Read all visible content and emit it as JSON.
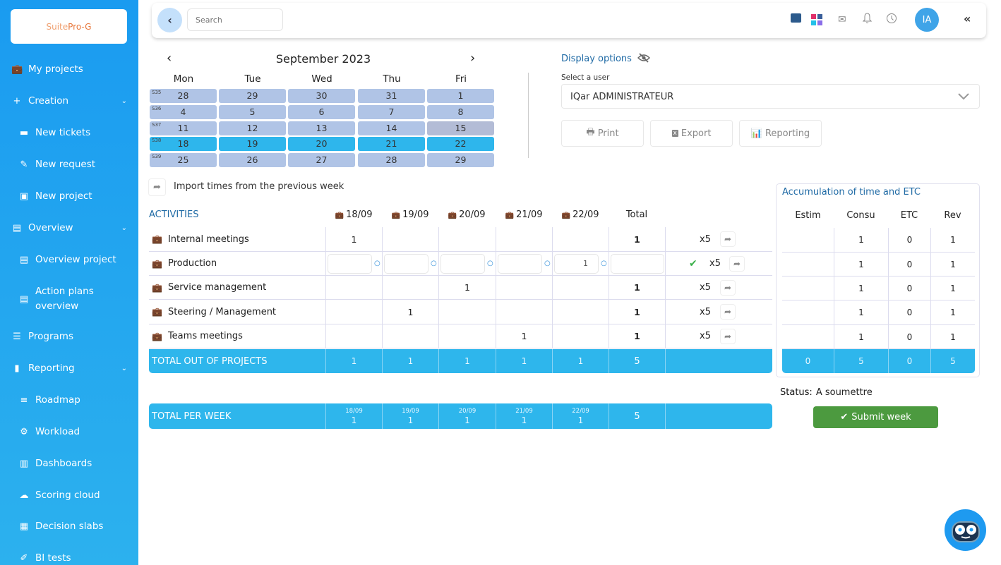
{
  "brand": {
    "logo_text_a": "Suite",
    "logo_text_b": "Pro-G"
  },
  "sidebar": {
    "items": [
      {
        "label": "My projects",
        "icon": "briefcase-icon",
        "glyph": "💼"
      },
      {
        "label": "Creation",
        "icon": "plus-icon",
        "glyph": "+"
      },
      {
        "label": "New tickets",
        "icon": "ticket-plus-icon",
        "glyph": "▬"
      },
      {
        "label": "New request",
        "icon": "paperclip-plus-icon",
        "glyph": "✎"
      },
      {
        "label": "New project",
        "icon": "briefcase-plus-icon",
        "glyph": "▣"
      },
      {
        "label": "Overview",
        "icon": "clipboard-icon",
        "glyph": "▤"
      },
      {
        "label": "Overview project",
        "icon": "clipboard-icon",
        "glyph": "▤"
      },
      {
        "label": "Action plans overview",
        "icon": "clipboard-icon",
        "glyph": "▤"
      },
      {
        "label": "Programs",
        "icon": "list-icon",
        "glyph": "☰"
      },
      {
        "label": "Reporting",
        "icon": "file-icon",
        "glyph": "▮"
      },
      {
        "label": "Roadmap",
        "icon": "roadmap-icon",
        "glyph": "≡"
      },
      {
        "label": "Workload",
        "icon": "users-gear-icon",
        "glyph": "⚙"
      },
      {
        "label": "Dashboards",
        "icon": "bar-chart-icon",
        "glyph": "▥"
      },
      {
        "label": "Scoring cloud",
        "icon": "cloud-icon",
        "glyph": "☁"
      },
      {
        "label": "Decision slabs",
        "icon": "table-icon",
        "glyph": "▦"
      },
      {
        "label": "BI tests",
        "icon": "test-tube-icon",
        "glyph": "✐"
      }
    ],
    "chevron": "⌄"
  },
  "topbar": {
    "search_placeholder": "Search",
    "avatar_initials": "IA",
    "collapse_glyph": "«",
    "back_glyph": "‹"
  },
  "calendar": {
    "title": "September 2023",
    "prev": "‹",
    "next": "›",
    "days": [
      "Mon",
      "Tue",
      "Wed",
      "Thu",
      "Fri"
    ],
    "weeks": [
      {
        "label": "S35",
        "dates": [
          "28",
          "29",
          "30",
          "31",
          "1"
        ]
      },
      {
        "label": "S36",
        "dates": [
          "4",
          "5",
          "6",
          "7",
          "8"
        ]
      },
      {
        "label": "S37",
        "dates": [
          "11",
          "12",
          "13",
          "14",
          "15"
        ]
      },
      {
        "label": "S38",
        "dates": [
          "18",
          "19",
          "20",
          "21",
          "22"
        ]
      },
      {
        "label": "S39",
        "dates": [
          "25",
          "26",
          "27",
          "28",
          "29"
        ]
      }
    ],
    "selected_week": "S38",
    "today": "15"
  },
  "display_options": {
    "title": "Display options",
    "select_label": "Select a user",
    "selected_user": "IQar ADMINISTRATEUR",
    "buttons": {
      "print": "Print",
      "export": "Export",
      "reporting": "Reporting"
    }
  },
  "import": {
    "label": "Import times from the previous week"
  },
  "timesheet": {
    "activities_header": "ACTIVITIES",
    "date_headers": [
      "18/09",
      "19/09",
      "20/09",
      "21/09",
      "22/09"
    ],
    "total_header": "Total",
    "rows": [
      {
        "name": "Internal meetings",
        "values": [
          "1",
          "",
          "",
          "",
          ""
        ],
        "total": "1",
        "multiplier": "x5",
        "editable": false
      },
      {
        "name": "Production",
        "values": [
          "",
          "",
          "",
          "",
          "1"
        ],
        "total": "",
        "multiplier": "x5",
        "editable": true
      },
      {
        "name": "Service management",
        "values": [
          "",
          "",
          "1",
          "",
          ""
        ],
        "total": "1",
        "multiplier": "x5",
        "editable": false
      },
      {
        "name": "Steering / Management",
        "values": [
          "",
          "1",
          "",
          "",
          ""
        ],
        "total": "1",
        "multiplier": "x5",
        "editable": false
      },
      {
        "name": "Teams meetings",
        "values": [
          "",
          "",
          "",
          "1",
          ""
        ],
        "total": "1",
        "multiplier": "x5",
        "editable": false
      }
    ],
    "total_out": {
      "label": "TOTAL OUT OF PROJECTS",
      "values": [
        "1",
        "1",
        "1",
        "1",
        "1"
      ],
      "total": "5"
    },
    "total_week": {
      "label": "TOTAL PER WEEK",
      "dates": [
        "18/09",
        "19/09",
        "20/09",
        "21/09",
        "22/09"
      ],
      "values": [
        "1",
        "1",
        "1",
        "1",
        "1"
      ],
      "total": "5"
    }
  },
  "accumulation": {
    "title": "Accumulation of time and ETC",
    "headers": [
      "Estim",
      "Consu",
      "ETC",
      "Rev"
    ],
    "rows": [
      [
        "",
        "1",
        "0",
        "1"
      ],
      [
        "",
        "1",
        "0",
        "1"
      ],
      [
        "",
        "1",
        "0",
        "1"
      ],
      [
        "",
        "1",
        "0",
        "1"
      ],
      [
        "",
        "1",
        "0",
        "1"
      ]
    ],
    "totals": [
      "0",
      "5",
      "0",
      "5"
    ]
  },
  "status": {
    "label": "Status:",
    "value": "A soumettre"
  },
  "submit": {
    "label": "Submit week"
  },
  "colors": {
    "sidebar": "#1a9bf0",
    "accent": "#2eb6ec",
    "link": "#1f6aa5",
    "submit": "#4c9a3f",
    "calendar_cell": "#b0c4e6"
  }
}
